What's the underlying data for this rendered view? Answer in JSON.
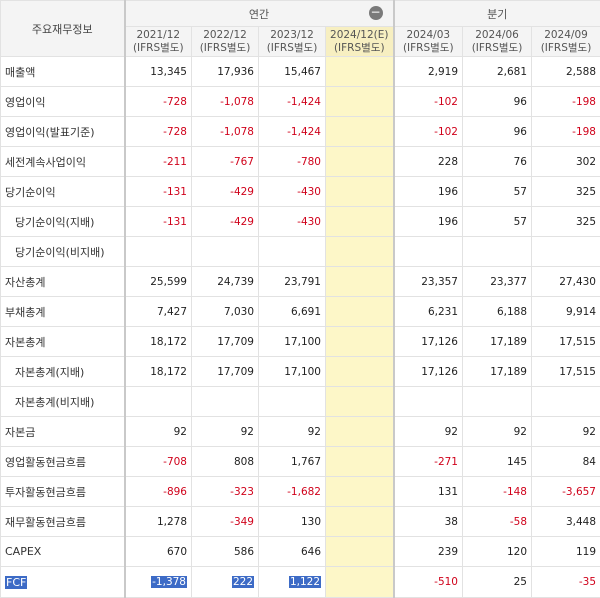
{
  "header": {
    "corner": "주요재무정보",
    "annual_label": "연간",
    "quarter_label": "분기",
    "collapse_icon": "minus-circle-icon",
    "collapse_glyph": "−",
    "annual_periods": [
      {
        "date": "2021/12",
        "basis": "(IFRS별도)"
      },
      {
        "date": "2022/12",
        "basis": "(IFRS별도)"
      },
      {
        "date": "2023/12",
        "basis": "(IFRS별도)"
      },
      {
        "date": "2024/12(E)",
        "basis": "(IFRS별도)"
      }
    ],
    "quarter_periods": [
      {
        "date": "2024/03",
        "basis": "(IFRS별도)"
      },
      {
        "date": "2024/06",
        "basis": "(IFRS별도)"
      },
      {
        "date": "2024/09",
        "basis": "(IFRS별도)"
      }
    ]
  },
  "rows": [
    {
      "label": "매출액",
      "sub": false,
      "values": [
        "13,345",
        "17,936",
        "15,467",
        "",
        "2,919",
        "2,681",
        "2,588"
      ]
    },
    {
      "label": "영업이익",
      "sub": false,
      "values": [
        "-728",
        "-1,078",
        "-1,424",
        "",
        "-102",
        "96",
        "-198"
      ]
    },
    {
      "label": "영업이익(발표기준)",
      "sub": false,
      "values": [
        "-728",
        "-1,078",
        "-1,424",
        "",
        "-102",
        "96",
        "-198"
      ]
    },
    {
      "label": "세전계속사업이익",
      "sub": false,
      "values": [
        "-211",
        "-767",
        "-780",
        "",
        "228",
        "76",
        "302"
      ]
    },
    {
      "label": "당기순이익",
      "sub": false,
      "values": [
        "-131",
        "-429",
        "-430",
        "",
        "196",
        "57",
        "325"
      ]
    },
    {
      "label": "당기순이익(지배)",
      "sub": true,
      "values": [
        "-131",
        "-429",
        "-430",
        "",
        "196",
        "57",
        "325"
      ]
    },
    {
      "label": "당기순이익(비지배)",
      "sub": true,
      "values": [
        "",
        "",
        "",
        "",
        "",
        "",
        ""
      ]
    },
    {
      "label": "자산총계",
      "sub": false,
      "values": [
        "25,599",
        "24,739",
        "23,791",
        "",
        "23,357",
        "23,377",
        "27,430"
      ]
    },
    {
      "label": "부채총계",
      "sub": false,
      "values": [
        "7,427",
        "7,030",
        "6,691",
        "",
        "6,231",
        "6,188",
        "9,914"
      ]
    },
    {
      "label": "자본총계",
      "sub": false,
      "values": [
        "18,172",
        "17,709",
        "17,100",
        "",
        "17,126",
        "17,189",
        "17,515"
      ]
    },
    {
      "label": "자본총계(지배)",
      "sub": true,
      "values": [
        "18,172",
        "17,709",
        "17,100",
        "",
        "17,126",
        "17,189",
        "17,515"
      ]
    },
    {
      "label": "자본총계(비지배)",
      "sub": true,
      "values": [
        "",
        "",
        "",
        "",
        "",
        "",
        ""
      ]
    },
    {
      "label": "자본금",
      "sub": false,
      "values": [
        "92",
        "92",
        "92",
        "",
        "92",
        "92",
        "92"
      ]
    },
    {
      "label": "영업활동현금흐름",
      "sub": false,
      "values": [
        "-708",
        "808",
        "1,767",
        "",
        "-271",
        "145",
        "84"
      ]
    },
    {
      "label": "투자활동현금흐름",
      "sub": false,
      "values": [
        "-896",
        "-323",
        "-1,682",
        "",
        "131",
        "-148",
        "-3,657"
      ]
    },
    {
      "label": "재무활동현금흐름",
      "sub": false,
      "values": [
        "1,278",
        "-349",
        "130",
        "",
        "38",
        "-58",
        "3,448"
      ]
    },
    {
      "label": "CAPEX",
      "sub": false,
      "values": [
        "670",
        "586",
        "646",
        "",
        "239",
        "120",
        "119"
      ]
    },
    {
      "label": "FCF",
      "sub": false,
      "selected": true,
      "values": [
        "-1,378",
        "222",
        "1,122",
        "",
        "-510",
        "25",
        "-35"
      ]
    }
  ],
  "colors": {
    "negative": "#d0021b",
    "estimate_bg": "#fdf7c8",
    "selection": "#3d6bc6"
  }
}
